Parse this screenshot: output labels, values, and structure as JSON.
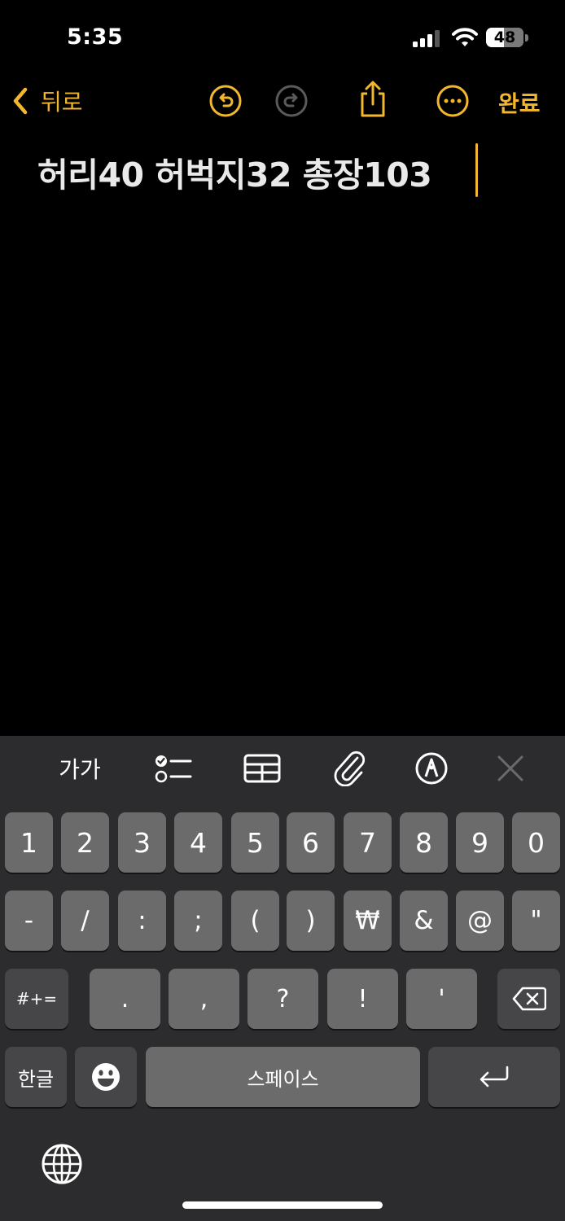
{
  "status_bar": {
    "time": "5:35",
    "battery": "48"
  },
  "nav": {
    "back_label": "뒤로",
    "done_label": "완료"
  },
  "note": {
    "text": "허리40 허벅지32 총장103"
  },
  "toolbar": {
    "format_label": "가가"
  },
  "keyboard": {
    "row1": [
      "1",
      "2",
      "3",
      "4",
      "5",
      "6",
      "7",
      "8",
      "9",
      "0"
    ],
    "row2": [
      "-",
      "/",
      ":",
      ";",
      "(",
      ")",
      "₩",
      "&",
      "@",
      "\""
    ],
    "row3": [
      ".",
      ",",
      "?",
      "!",
      "'"
    ],
    "symbols_label": "#+=",
    "hangul_label": "한글",
    "space_label": "스페이스"
  },
  "colors": {
    "accent": "#f2b72e",
    "key": "#6b6b6b",
    "key_dark": "#464648",
    "keyboard_bg": "#2c2c2e"
  }
}
